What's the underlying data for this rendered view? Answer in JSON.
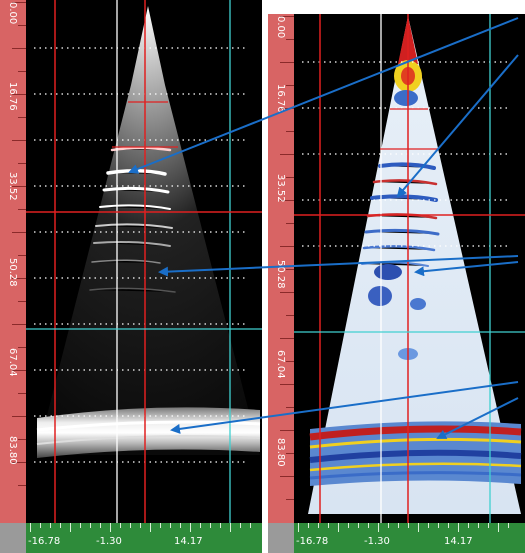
{
  "left_panel": {
    "depth_labels": [
      "0.00",
      "16.76",
      "33.52",
      "50.28",
      "67.04",
      "83.80"
    ],
    "lateral_labels": [
      "-16.78",
      "-1.30",
      "14.17"
    ]
  },
  "right_panel": {
    "depth_labels": [
      "0.00",
      "16.76",
      "33.52",
      "50.28",
      "67.04",
      "83.80"
    ],
    "lateral_labels": [
      "-16.78",
      "-1.30",
      "14.17"
    ]
  },
  "colors": {
    "depth_ruler": "#d86464",
    "lateral_ruler": "#2e8b3a",
    "crosshair_red": "#e02020",
    "crosshair_white": "#ffffff",
    "crosshair_cyan": "#40d0d0",
    "annotation_arrow": "#1a6ec8"
  }
}
